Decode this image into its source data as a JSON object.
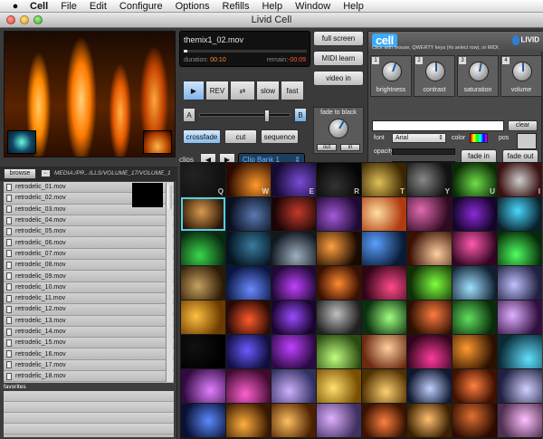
{
  "menubar": {
    "apple": "",
    "items": [
      "Cell",
      "File",
      "Edit",
      "Configure",
      "Options",
      "Refills",
      "Help",
      "Window",
      "Help"
    ]
  },
  "window": {
    "title": "Livid Cell"
  },
  "deck": {
    "filename": "themix1_02.mov",
    "duration_label": "duration:",
    "duration_value": "00:10",
    "remain_label": "remain:",
    "remain_value": "-00:09",
    "progress": 0.03,
    "transport": {
      "play": "▶",
      "rev": "REV",
      "loop": "⇄",
      "slow": "slow",
      "fast": "fast"
    },
    "xfade": {
      "a": "A",
      "b": "B",
      "position": 0.75
    },
    "modes": {
      "crossfade": "crossfade",
      "cut": "cut",
      "sequence": "sequence"
    },
    "clips_label": "clips",
    "bank_value": "Clip Bank 1",
    "edit": "edit"
  },
  "side": {
    "fullscreen": "full screen",
    "midi": "MIDI learn",
    "video": "video in",
    "fade_label": "fade to black",
    "out": "out",
    "in": "in"
  },
  "fx": {
    "logo": "cell",
    "hint": "Click with mouse, QWERTY keys (#s select row), or MIDI.",
    "brand": "LIVID",
    "knobs": [
      {
        "num": "1",
        "label": "brightness",
        "angle": 200
      },
      {
        "num": "2",
        "label": "contrast",
        "angle": 180
      },
      {
        "num": "3",
        "label": "saturation",
        "angle": 190
      },
      {
        "num": "4",
        "label": "volume",
        "angle": 180
      }
    ],
    "text": {
      "clear": "clear",
      "font_label": "font",
      "font_value": "Arial",
      "color_label": "color",
      "pos_label": "pos",
      "opacity_label": "opacity",
      "size_label": "size",
      "size_level": 0.24,
      "fade_in": "fade in",
      "fade_out": "fade out"
    }
  },
  "browse": {
    "button": "browse",
    "path": "MEDIA:/PR...ILLS/VOLUME_17/VOLUME_1",
    "files": [
      "retrodelic_01.mov",
      "retrodelic_02.mov",
      "retrodelic_03.mov",
      "retrodelic_04.mov",
      "retrodelic_05.mov",
      "retrodelic_06.mov",
      "retrodelic_07.mov",
      "retrodelic_08.mov",
      "retrodelic_09.mov",
      "retrodelic_10.mov",
      "retrodelic_11.mov",
      "retrodelic_12.mov",
      "retrodelic_13.mov",
      "retrodelic_14.mov",
      "retrodelic_15.mov",
      "retrodelic_16.mov",
      "retrodelic_17.mov",
      "retrodelic_18.mov"
    ],
    "favorites_label": "favorites"
  },
  "clips": {
    "keys": [
      "Q",
      "W",
      "E",
      "R",
      "T",
      "Y",
      "U",
      "I"
    ],
    "selected_index": 8,
    "colors": [
      [
        "#222",
        "#111"
      ],
      [
        "#ff9a2a",
        "#2a0a00"
      ],
      [
        "#7a4bd6",
        "#150a30"
      ],
      [
        "#333",
        "#050505"
      ],
      [
        "#e0c05a",
        "#3a2500"
      ],
      [
        "#888",
        "#111"
      ],
      [
        "#6fe04a",
        "#0a2a05"
      ],
      [
        "#cfcfcf",
        "#3a1010"
      ],
      [
        "#d89a50",
        "#2a1505"
      ],
      [
        "#5a7ab0",
        "#0a1020"
      ],
      [
        "#c23a2a",
        "#1a0505"
      ],
      [
        "#a35ad8",
        "#200a35"
      ],
      [
        "#ffe0a0",
        "#b03a10"
      ],
      [
        "#e06ab0",
        "#300a20"
      ],
      [
        "#8a2ad8",
        "#15052a"
      ],
      [
        "#4ad8ff",
        "#08202a"
      ],
      [
        "#3ad84a",
        "#0a2a10"
      ],
      [
        "#3a7aa0",
        "#051520"
      ],
      [
        "#a0b0c0",
        "#101820"
      ],
      [
        "#ffa040",
        "#1a0a00"
      ],
      [
        "#5aa0ff",
        "#0a1a35"
      ],
      [
        "#ffd0a0",
        "#3a1005"
      ],
      [
        "#ff5ab0",
        "#300520"
      ],
      [
        "#50ff60",
        "#052a08"
      ],
      [
        "#c8a060",
        "#2a1a05"
      ],
      [
        "#6a8aff",
        "#0a1540"
      ],
      [
        "#c040ff",
        "#200a35"
      ],
      [
        "#ff8a30",
        "#3a1000"
      ],
      [
        "#ff4a8a",
        "#300515"
      ],
      [
        "#80ff40",
        "#103005"
      ],
      [
        "#a0e0ff",
        "#102030"
      ],
      [
        "#c0c0ff",
        "#202040"
      ],
      [
        "#ffc040",
        "#6a3a00"
      ],
      [
        "#ff5a2a",
        "#2a0a05"
      ],
      [
        "#9a4aff",
        "#1a0530"
      ],
      [
        "#c0c0c0",
        "#202020"
      ],
      [
        "#a0ff80",
        "#0a3010"
      ],
      [
        "#ff7a40",
        "#2a1000"
      ],
      [
        "#60e060",
        "#0a2a0a"
      ],
      [
        "#e0b0ff",
        "#301040"
      ],
      [
        "#111",
        "#000"
      ],
      [
        "#6a5aff",
        "#101040"
      ],
      [
        "#c040ff",
        "#2a0a40"
      ],
      [
        "#c0ff80",
        "#2a4a10"
      ],
      [
        "#ffd0a0",
        "#6a2a10"
      ],
      [
        "#ff3aa0",
        "#30051a"
      ],
      [
        "#ff9a30",
        "#2a1000"
      ],
      [
        "#60e0ff",
        "#0a2a35"
      ],
      [
        "#e080ff",
        "#300a40"
      ],
      [
        "#ff60d0",
        "#400a30"
      ],
      [
        "#d0b0ff",
        "#303060"
      ],
      [
        "#ffe070",
        "#7a5000"
      ],
      [
        "#ffd070",
        "#503000"
      ],
      [
        "#c0d0ff",
        "#101830"
      ],
      [
        "#ff8040",
        "#401000"
      ],
      [
        "#d0d0ff",
        "#202040"
      ],
      [
        "#5a8aff",
        "#0a1030"
      ],
      [
        "#ffb040",
        "#3a1800"
      ],
      [
        "#ffc060",
        "#4a2000"
      ],
      [
        "#e0b0ff",
        "#403060"
      ],
      [
        "#ff8040",
        "#3a1200"
      ],
      [
        "#ffc070",
        "#3a2000"
      ],
      [
        "#e07030",
        "#2a0a00"
      ],
      [
        "#ffc0ff",
        "#503050"
      ]
    ]
  }
}
